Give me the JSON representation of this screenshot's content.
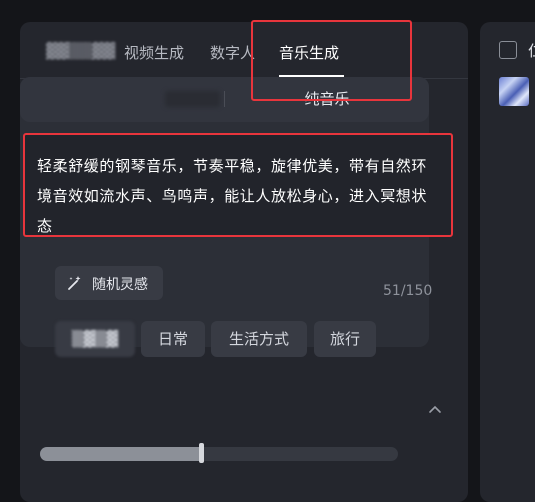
{
  "tabs": [
    {
      "label": "视频生成",
      "active": false
    },
    {
      "label": "数字人",
      "active": false
    },
    {
      "label": "音乐生成",
      "active": true
    }
  ],
  "mode_selector": {
    "right_label": "纯音乐"
  },
  "prompt": {
    "value": "轻柔舒缓的钢琴音乐，节奏平稳，旋律优美，带有自然环境音效如流水声、鸟鸣声，能让人放松身心，进入冥想状态"
  },
  "inspiration_button": {
    "label": "随机灵感",
    "icon": "magic-wand-icon"
  },
  "char_count": "51/150",
  "tags": [
    "日常",
    "生活方式",
    "旅行"
  ],
  "slider": {
    "value_fraction": 0.45
  },
  "right_panel": {
    "heading": "仁"
  },
  "colors": {
    "highlight": "#e8353c",
    "background": "#141519",
    "panel": "#24262d"
  }
}
